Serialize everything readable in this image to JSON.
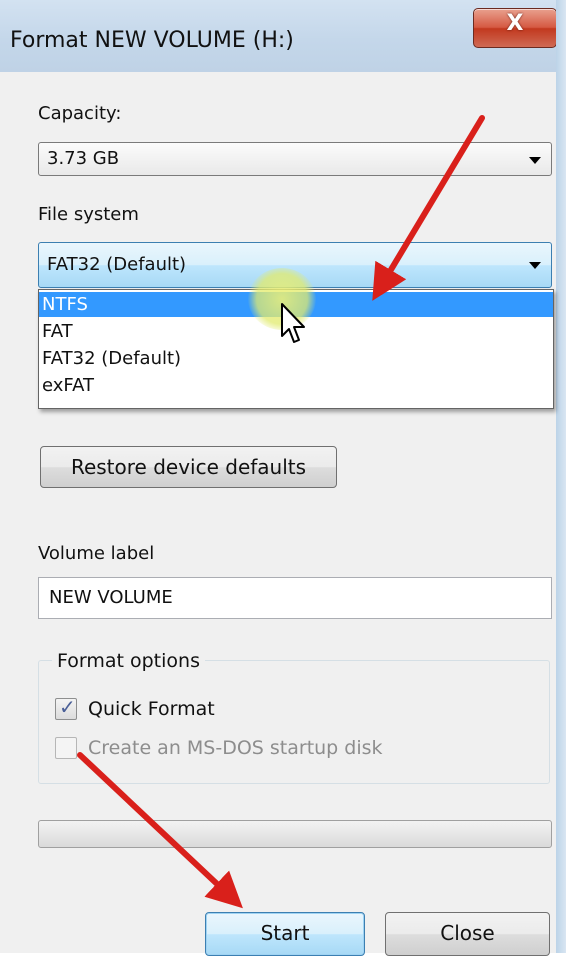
{
  "window": {
    "title": "Format NEW VOLUME (H:)",
    "close_glyph": "X"
  },
  "capacity": {
    "label": "Capacity:",
    "value": "3.73 GB"
  },
  "file_system": {
    "label": "File system",
    "value": "FAT32 (Default)",
    "options": [
      "NTFS",
      "FAT",
      "FAT32 (Default)",
      "exFAT"
    ],
    "highlighted_option": "NTFS"
  },
  "restore_button": {
    "label": "Restore device defaults"
  },
  "volume_label": {
    "label": "Volume label",
    "value": "NEW VOLUME"
  },
  "format_options": {
    "legend": "Format options",
    "quick_format": {
      "label": "Quick Format",
      "checked": true
    },
    "msdos_startup": {
      "label": "Create an MS-DOS startup disk",
      "checked": false,
      "enabled": false
    }
  },
  "progress": {
    "fraction": 0
  },
  "buttons": {
    "start": "Start",
    "close": "Close"
  },
  "annotations": {
    "arrow_color": "#d9201b",
    "highlight_color": "#e6ec78"
  },
  "icons": {
    "cursor": "mouse-pointer-icon",
    "dropdown": "chevron-down-icon",
    "checkmark": "checkmark-icon"
  }
}
